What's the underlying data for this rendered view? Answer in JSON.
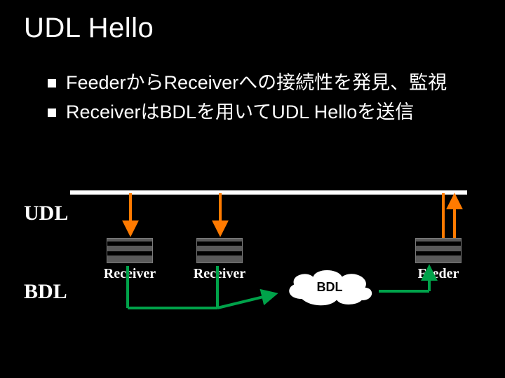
{
  "title": "UDL Hello",
  "bullets": [
    "FeederからReceiverへの接続性を発見、監視",
    "ReceiverはBDLを用いてUDL Helloを送信"
  ],
  "diagram": {
    "udl_label": "UDL",
    "bdl_label": "BDL",
    "receiver1_label": "Receiver",
    "receiver2_label": "Receiver",
    "feeder_label": "Feeder",
    "cloud_label": "BDL",
    "colors": {
      "orange": "#ff7a00",
      "green": "#00a24a"
    }
  }
}
